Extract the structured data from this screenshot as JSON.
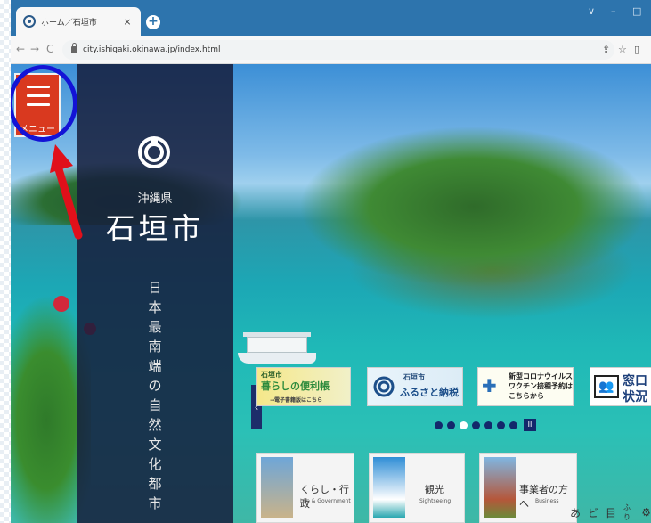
{
  "browser": {
    "tab_title": "ホーム／石垣市",
    "tab_close": "×",
    "new_tab": "+",
    "url": "city.ishigaki.okinawa.jp/index.html",
    "window_controls": [
      "∨",
      "–",
      "□"
    ]
  },
  "site": {
    "menu_label": "メニュー",
    "prefecture": "沖縄県",
    "city": "石垣市",
    "tagline": "日本最南端の自然文化都市"
  },
  "banners": [
    {
      "title": "石垣市",
      "subtitle": "暮らしの便利帳",
      "note": "→電子書籍版はこちら"
    },
    {
      "title": "石垣市",
      "subtitle": "ふるさと納税"
    },
    {
      "title": "新型コロナウイルス",
      "subtitle": "ワクチン接種予約は",
      "note": "こちらから"
    },
    {
      "title": "窓口",
      "subtitle": "状況"
    }
  ],
  "carousel": {
    "dot_count": 7,
    "active_index": 2,
    "pause_label": "II",
    "prev_label": "‹"
  },
  "cards": [
    {
      "label": "くらし・行政",
      "sub": "Life & Government"
    },
    {
      "label": "観光",
      "sub": "Sightseeing"
    },
    {
      "label": "事業者の方へ",
      "sub": "Business"
    }
  ],
  "accessibility_bar": [
    "あ",
    "ビ",
    "目",
    "ふり",
    "⚙"
  ],
  "colors": {
    "menu_red": "#d9391f",
    "highlight_blue": "#1313d6",
    "arrow_red": "#e0101a",
    "panel_navy": "#161e3c"
  }
}
